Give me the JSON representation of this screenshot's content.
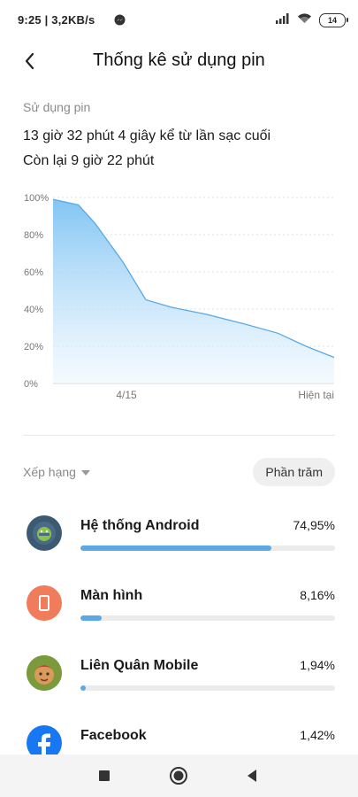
{
  "status_bar": {
    "time": "9:25 | 3,2KB/s",
    "battery_level": "14"
  },
  "header": {
    "title": "Thống kê sử dụng pin"
  },
  "summary": {
    "section_label": "Sử dụng pin",
    "since_last_charge": "13 giờ 32 phút 4 giây kể từ lần sạc cuối",
    "remaining": "Còn lại 9 giờ 22 phút"
  },
  "chart_data": {
    "type": "area",
    "y_ticks": [
      "100%",
      "80%",
      "60%",
      "40%",
      "20%",
      "0%"
    ],
    "x_tick_labels": [
      "4/15",
      "Hiện tại"
    ],
    "ylim": [
      0,
      100
    ],
    "x": [
      0,
      0.09,
      0.15,
      0.25,
      0.33,
      0.42,
      0.55,
      0.68,
      0.8,
      0.9,
      1.0
    ],
    "y": [
      99,
      96,
      86,
      65,
      45,
      41,
      37,
      32,
      27,
      20,
      14
    ],
    "colors": {
      "line": "#5aa9e6",
      "fill_top": "#7cc2f3",
      "fill_bottom": "#eef7fe"
    },
    "grid": true
  },
  "ranking": {
    "sort_label": "Xếp hạng",
    "mode_button": "Phần trăm"
  },
  "apps": [
    {
      "name": "Hệ thống Android",
      "percent": "74,95%",
      "value": 74.95,
      "icon": "android-icon",
      "color": "#3d5a73"
    },
    {
      "name": "Màn hình",
      "percent": "8,16%",
      "value": 8.16,
      "icon": "screen-icon",
      "color": "#f07c5c"
    },
    {
      "name": "Liên Quân Mobile",
      "percent": "1,94%",
      "value": 1.94,
      "icon": "game-icon",
      "color": "#6d8a3a"
    },
    {
      "name": "Facebook",
      "percent": "1,42%",
      "value": 1.42,
      "icon": "facebook-icon",
      "color": "#1877f2"
    }
  ],
  "colors": {
    "accent": "#5aa9e6"
  }
}
